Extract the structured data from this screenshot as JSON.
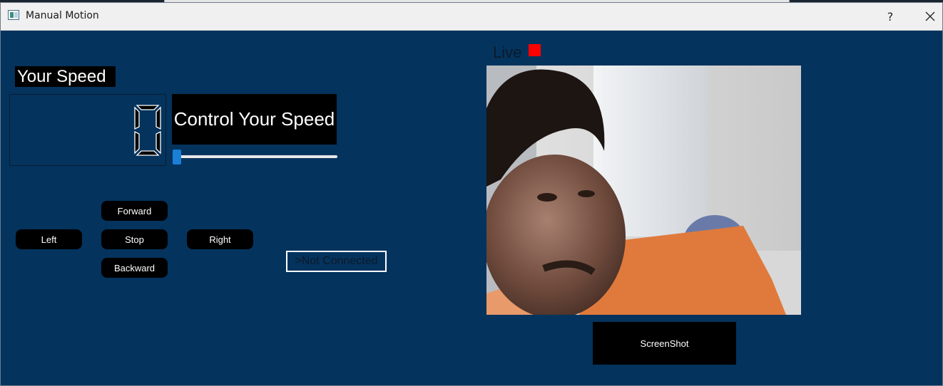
{
  "window": {
    "title": "Manual Motion",
    "help_label": "?",
    "close_icon": "close-icon",
    "app_icon": "window-app-icon"
  },
  "speed": {
    "label": "Your Speed",
    "display_value": "0",
    "control_label": "Control Your Speed",
    "slider_value": 0
  },
  "controls": {
    "forward": "Forward",
    "left": "Left",
    "stop": "Stop",
    "right": "Right",
    "backward": "Backward"
  },
  "connection": {
    "status": ">Not Connected"
  },
  "camera": {
    "live_label": "Live",
    "live_indicator_color": "#ff0000",
    "feed": "webcam-feed-image",
    "screenshot_label": "ScreenShot"
  },
  "colors": {
    "window_bg": "#04335d",
    "button_bg": "#000000",
    "slider_accent": "#1a7fd6"
  }
}
